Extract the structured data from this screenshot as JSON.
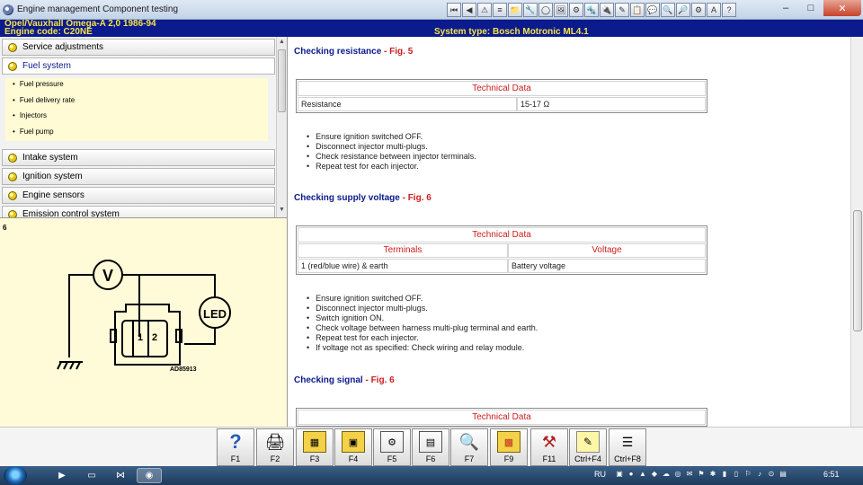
{
  "window": {
    "title": "Engine management Component testing",
    "minimize": "–",
    "maximize": "□",
    "close": "✕"
  },
  "header": {
    "vehicle": "Opel/Vauxhall   Omega-A  2,0  1986-94",
    "engine_code": "Engine code: C20NE",
    "system_type": "System type: Bosch Motronic ML4.1"
  },
  "toolbar": [
    "⏮",
    "◀",
    "⚠",
    "≡",
    "📁",
    "🔧",
    "◯",
    "🖼",
    "⚙",
    "🔩",
    "🔌",
    "✎",
    "📋",
    "💬",
    "🔍",
    "🔎",
    "⚙",
    "A",
    "?"
  ],
  "menu": {
    "items": [
      {
        "label": "Service adjustments"
      },
      {
        "label": "Fuel system"
      },
      {
        "label": "Intake system"
      },
      {
        "label": "Ignition system"
      },
      {
        "label": "Engine sensors"
      },
      {
        "label": "Emission control system"
      }
    ],
    "sub_items": [
      "Fuel pressure",
      "Fuel delivery rate",
      "Injectors",
      "Fuel pump"
    ]
  },
  "diagram": {
    "figure_number": "6",
    "voltmeter_label": "V",
    "led_label": "LED",
    "pin1": "1",
    "pin2": "2",
    "code": "AD85913"
  },
  "content": {
    "sections": [
      {
        "title": "Checking resistance",
        "fig": " - Fig. 5",
        "table": {
          "caption": "Technical Data",
          "rows": [
            [
              "Resistance",
              "15-17 Ω"
            ]
          ]
        },
        "steps": [
          "Ensure ignition switched OFF.",
          "Disconnect injector multi-plugs.",
          "Check resistance between injector terminals.",
          "Repeat test for each injector."
        ]
      },
      {
        "title": "Checking supply voltage",
        "fig": " - Fig. 6",
        "table": {
          "caption": "Technical Data",
          "headers": [
            "Terminals",
            "Voltage"
          ],
          "rows": [
            [
              "1 (red/blue wire) & earth",
              "Battery voltage"
            ]
          ]
        },
        "steps": [
          "Ensure ignition switched OFF.",
          "Disconnect injector multi-plugs.",
          "Switch ignition ON.",
          "Check voltage between harness multi-plug terminal and earth.",
          "Repeat test for each injector.",
          "If voltage not as specified: Check wiring and relay module."
        ]
      },
      {
        "title": "Checking signal",
        "fig": " - Fig. 6",
        "table": {
          "caption": "Technical Data"
        }
      }
    ]
  },
  "fkeys": [
    {
      "label": "F1",
      "icon": "help-icon"
    },
    {
      "label": "F2",
      "icon": "print-icon"
    },
    {
      "label": "F3",
      "icon": "copy-icon"
    },
    {
      "label": "F4",
      "icon": "paste-icon"
    },
    {
      "label": "F5",
      "icon": "component-icon"
    },
    {
      "label": "F6",
      "icon": "connector-icon"
    },
    {
      "label": "F7",
      "icon": "zoom-icon"
    },
    {
      "label": "F9",
      "icon": "pages-icon"
    },
    {
      "label": "F11",
      "icon": "tools-icon"
    },
    {
      "label": "Ctrl+F4",
      "icon": "notes-icon"
    },
    {
      "label": "Ctrl+F8",
      "icon": "list-icon"
    }
  ],
  "taskbar": {
    "language": "RU",
    "clock": "6:51"
  }
}
